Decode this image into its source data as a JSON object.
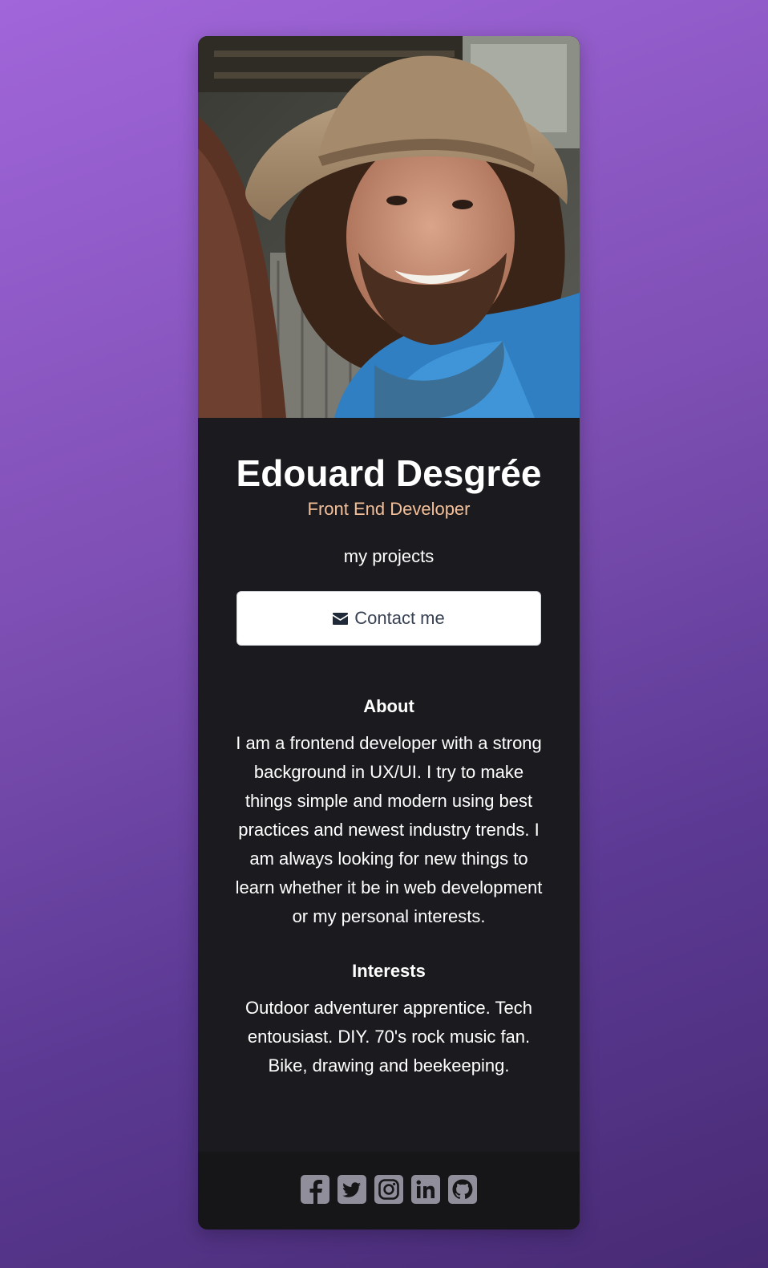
{
  "profile": {
    "photo_icon": "portrait-photo",
    "name": "Edouard Desgrée",
    "role": "Front End Developer"
  },
  "actions": {
    "projects_label": "my projects",
    "contact_label": "Contact me",
    "contact_icon": "envelope-icon"
  },
  "about": {
    "title": "About",
    "text": "I am a frontend developer with a strong background in UX/UI. I try to make things simple and modern using best practices and newest industry trends. I am always looking for new things to learn whether it be in web development or my personal interests."
  },
  "interests": {
    "title": "Interests",
    "text": "Outdoor adventurer apprentice. Tech entousiast. DIY. 70's rock music fan. Bike, drawing and beekeeping."
  },
  "footer": {
    "social_icons": [
      "facebook-icon",
      "twitter-icon",
      "instagram-icon",
      "linkedin-icon",
      "github-icon"
    ]
  },
  "colors": {
    "background_start": "#a166da",
    "background_end": "#472a74",
    "card": "#1b1b1f",
    "footer": "#161619",
    "accent": "#f3bf99",
    "icon": "#918e9b"
  }
}
